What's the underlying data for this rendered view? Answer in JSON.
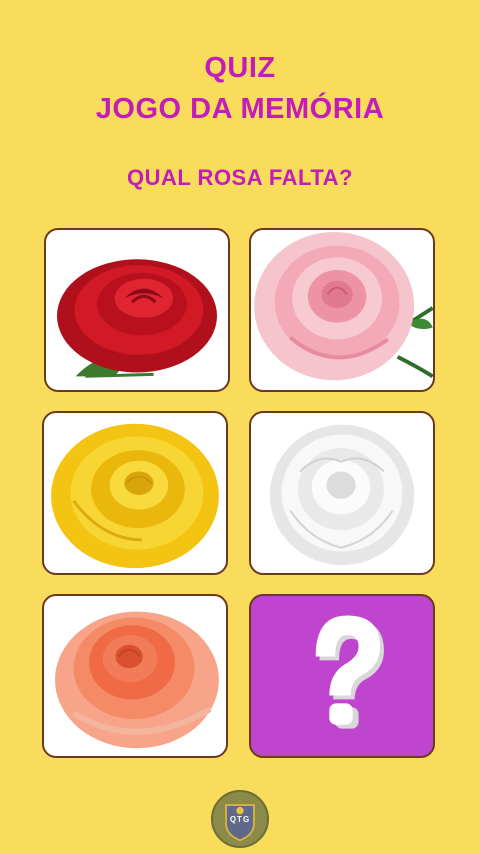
{
  "header": {
    "line1": "QUIZ",
    "line2": "JOGO DA MEMÓRIA",
    "question": "QUAL ROSA FALTA?"
  },
  "cards": [
    {
      "rose": "red rose",
      "color": "#c8101e"
    },
    {
      "rose": "pink rose",
      "color": "#f2a6b6"
    },
    {
      "rose": "yellow rose",
      "color": "#f3c40f"
    },
    {
      "rose": "white rose",
      "color": "#f4f4f4"
    },
    {
      "rose": "orange rose",
      "color": "#f48a68"
    },
    {
      "rose": "question-mark-icon",
      "color": "#bf45cf"
    }
  ],
  "logo": {
    "text": "QTG"
  },
  "colors": {
    "background": "#f9dc5c",
    "title": "#c21dba",
    "card_border": "#6b3a1e"
  }
}
